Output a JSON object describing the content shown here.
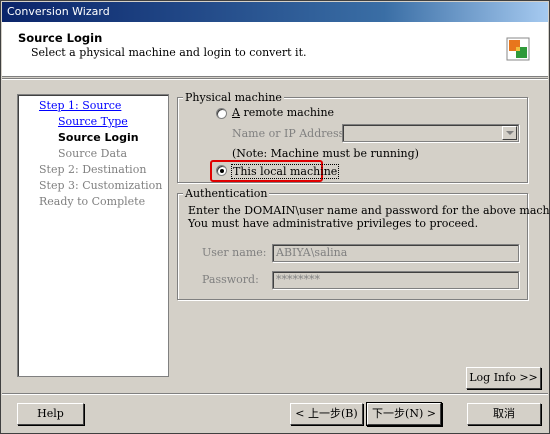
{
  "window": {
    "title": "Conversion Wizard"
  },
  "header": {
    "title": "Source Login",
    "subtitle": "Select a physical machine and login to convert it.",
    "logo_icon": "converter-logo-icon"
  },
  "steps": [
    {
      "label": "Step 1: Source",
      "state": "link"
    },
    {
      "label": "Source Type",
      "state": "link"
    },
    {
      "label": "Source Login",
      "state": "active"
    },
    {
      "label": "Source Data",
      "state": "dim"
    },
    {
      "label": "Step 2: Destination",
      "state": "dim"
    },
    {
      "label": "Step 3: Customization",
      "state": "dim"
    },
    {
      "label": "Ready to Complete",
      "state": "dim"
    }
  ],
  "physical_machine": {
    "legend": "Physical machine",
    "remote_label": "A remote machine",
    "name_ip_label": "Name or IP Address:",
    "name_ip_value": "",
    "note": "(Note: Machine must be running)",
    "local_label": "This local machine",
    "selected": "local"
  },
  "authentication": {
    "legend": "Authentication",
    "description_line1": "Enter the DOMAIN\\user name and password for the above machine.",
    "description_line2": "You must have administrative privileges to proceed.",
    "username_label": "User name:",
    "username_value": "ABIYA\\salina",
    "password_label": "Password:",
    "password_value": "********"
  },
  "buttons": {
    "log_info": "Log Info >>",
    "help": "Help",
    "back": "< 上一步(B)",
    "next": "下一步(N) >",
    "cancel": "取消"
  },
  "colors": {
    "title_gradient_start": "#0a246a",
    "highlight_border": "#e00000",
    "link": "#0000ff"
  }
}
